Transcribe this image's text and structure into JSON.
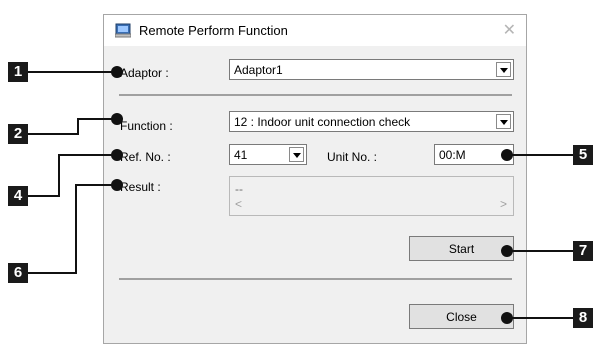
{
  "caption": "Remote perform function window (callouts)",
  "window": {
    "title": "Remote Perform Function"
  },
  "adaptor": {
    "label": "Adaptor :",
    "value": "Adaptor1"
  },
  "function": {
    "label": "Function :",
    "value": "12 : Indoor unit connection check"
  },
  "ref": {
    "label": "Ref. No. :",
    "value": "41"
  },
  "unit": {
    "label": "Unit No. :",
    "value": "00:M"
  },
  "result": {
    "label": "Result :",
    "value": "--",
    "scroll_left": "<",
    "scroll_right": ">"
  },
  "buttons": {
    "start": "Start",
    "close": "Close"
  },
  "callouts": [
    "1",
    "2",
    "4",
    "6",
    "5",
    "7",
    "8"
  ]
}
